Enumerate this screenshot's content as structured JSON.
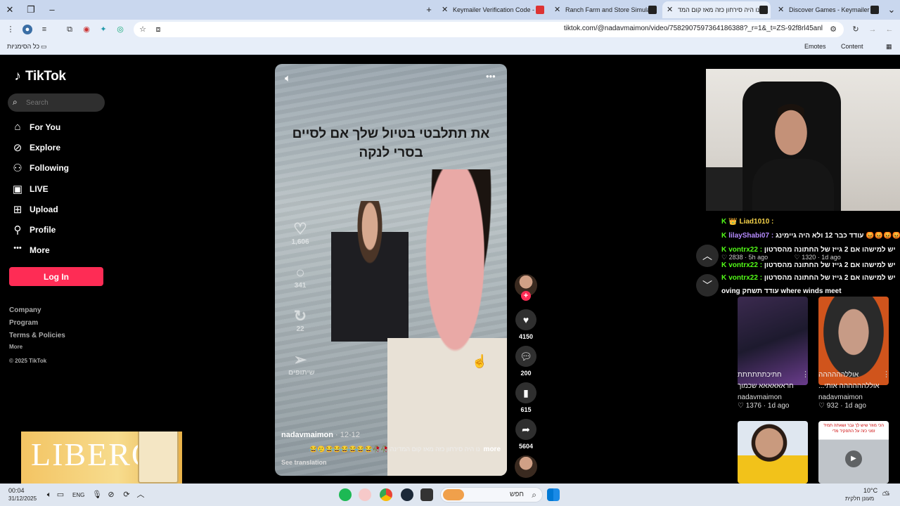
{
  "browser": {
    "tabs": [
      {
        "title": "Keymailer Verification Code - s"
      },
      {
        "title": "Ranch Farm and Store Simulato"
      },
      {
        "title": "נו היה סירחון כזה מאז קום המד"
      },
      {
        "title": "Discover Games - Keymailer"
      }
    ],
    "url": "tiktok.com/@nadavmaimon/video/7582907597364186388?_r=1&_t=ZS-92f8rl45anl",
    "bookmarks_all": "כל הסימניות",
    "emotes": "Emotes",
    "content": "Content"
  },
  "sidebar": {
    "logo": "TikTok",
    "search_placeholder": "Search",
    "nav": [
      {
        "label": "For You",
        "icon": "home-icon"
      },
      {
        "label": "Explore",
        "icon": "compass-icon"
      },
      {
        "label": "Following",
        "icon": "following-icon"
      },
      {
        "label": "LIVE",
        "icon": "live-icon"
      },
      {
        "label": "Upload",
        "icon": "upload-icon"
      },
      {
        "label": "Profile",
        "icon": "profile-icon"
      },
      {
        "label": "More",
        "icon": "more-icon"
      }
    ],
    "login": "Log In",
    "footer": {
      "company": "Company",
      "program": "Program",
      "terms": "Terms & Policies",
      "more": "More",
      "copyright": "© 2025 TikTok"
    }
  },
  "ad": {
    "brand": "LIBERO"
  },
  "video": {
    "overlay_text": "את תתלבטי בטיול שלך אם לסיים בסרי לנקה",
    "author": "nadavmaimon",
    "date": "· 12-12",
    "caption": "נו היה סירחון כזה מאז קום המדינה 🥀🥀😂😂😂😂😂😂🥲😂",
    "more": "more",
    "see_translation": "See translation",
    "ghost_counts": [
      "1,606",
      "341",
      "22",
      "שיתופים"
    ]
  },
  "actions": {
    "likes": "4150",
    "comments": "200",
    "saves": "615",
    "shares": "5604"
  },
  "stream": {
    "chat": [
      {
        "user": "Liad1010 :",
        "message": "",
        "badge": "👑"
      },
      {
        "user": "lilayShabi07 :",
        "message": "עודד כבר 12 ולא היה גיימינג 😡😡😡😡😡"
      },
      {
        "user": "vontrx22 :",
        "message": "יש למישהו אם 2 גייז של החתונה מהסרטון"
      },
      {
        "user": "vontrx22 :",
        "message": "יש למישהו אם 2 גייז של החתונה מהסרטון"
      },
      {
        "user": "vontrx22 :",
        "message": "יש למישהו אם 2 גייז של החתונה מהסרטון"
      },
      {
        "user": "",
        "message": "oving עודד תשחק where winds meet"
      }
    ],
    "ghost_rows": [
      {
        "likes": "2838",
        "time": "5h ago"
      },
      {
        "likes": "1320",
        "time": "1d ago"
      }
    ]
  },
  "feed": [
    {
      "title1": "חתיכתתתתתת",
      "title2": "חראאאאאא שכמוך",
      "author": "nadavmaimon",
      "likes": "1376",
      "time": "1d ago"
    },
    {
      "title1": "אוללהההההה",
      "title2": "...אוללהההההה אותי",
      "author": "nadavmaimon",
      "likes": "932",
      "time": "1d ago"
    }
  ],
  "feed_row2_text": "הכי מוזר שיש לך גבר ושאתה תמיד זמני כזה על התפקיד מדי",
  "taskbar": {
    "time": "00:04",
    "date": "31/12/2025",
    "lang": "ENG",
    "search_placeholder": "חפש",
    "temp": "10°C",
    "weather": "מעונן חלקית"
  }
}
